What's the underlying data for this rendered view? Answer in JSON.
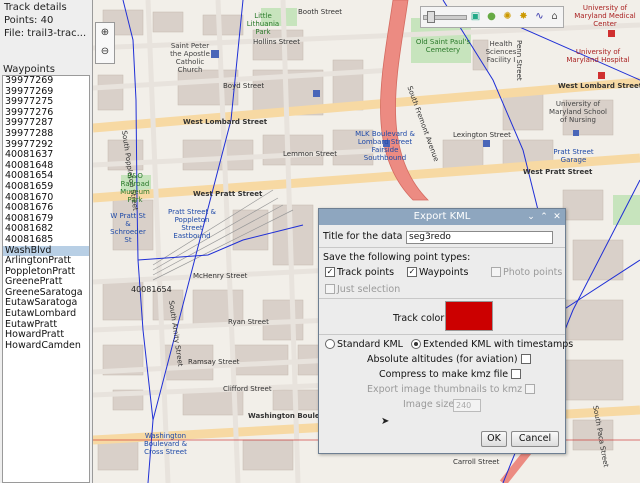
{
  "track_details": {
    "title": "Track details",
    "points": "Points: 40",
    "file": "File: trail3-trac..."
  },
  "waypoints": {
    "header": "Waypoints",
    "items": [
      "39977269",
      "39977269",
      "39977275",
      "39977276",
      "39977287",
      "39977288",
      "39977292",
      "40081637",
      "40081648",
      "40081654",
      "40081659",
      "40081670",
      "40081676",
      "40081679",
      "40081682",
      "40081685",
      "WashBlvd",
      "ArlingtonPratt",
      "PoppletonPratt",
      "GreenePratt",
      "GreeneSaratoga",
      "EutawSaratoga",
      "EutawLombard",
      "EutawPratt",
      "HowardPratt",
      "HowardCamden"
    ],
    "selected_index": 16
  },
  "map": {
    "labels": {
      "booth": "Booth Street",
      "hollins": "Hollins Street",
      "boyd": "Boyd Street",
      "lombard": "West Lombard Street",
      "pratt": "West Pratt Street",
      "lemmon": "Lemmon Street",
      "lexington": "Lexington Street",
      "mchenry": "McHenry Street",
      "ryan": "Ryan Street",
      "ramsay": "Ramsay Street",
      "clifford": "Clifford Street",
      "washington": "Washington Boulevard",
      "carroll": "Carroll Street",
      "poppleton": "South Poppleton Street",
      "amity": "South Amity Street",
      "fremont": "South Fremont Avenue",
      "saint_peter": "Saint Peter the Apostle Catholic Church",
      "old_saint_paul": "Old Saint Paul's Cemetery",
      "health_sciences": "Health Sciences Facility I",
      "umd_medical": "University of Maryland Medical Center",
      "umd_school_med": "University of Maryland School of Medicine",
      "umd_hospital": "University of Maryland Hospital",
      "umd_nursing": "University of Maryland School of Nursing",
      "little_lithuania": "Little Lithuania Park",
      "bo_museum": "B&O Railroad Museum Park",
      "pratt_poppleton": "Pratt Street & Poppleton Street Eastbound",
      "w_pratt_schroeder": "W Pratt St & Schroeder St",
      "mlk_blvd": "MLK Boulevard & Lombard Street Fairside Southbound",
      "pratt_street_garage": "Pratt Street Garage",
      "washington_cross": "Washington Boulevard & Cross Street",
      "waypoint_marker": "40081654",
      "penn_street": "Penn Street",
      "paca_street": "South Paca Street"
    }
  },
  "dialog": {
    "title": "Export KML",
    "title_label": "Title for the data",
    "title_value": "seg3redo",
    "save_label": "Save the following point types:",
    "track_points": "Track points",
    "waypoints": "Waypoints",
    "photo_points": "Photo points",
    "just_selection": "Just selection",
    "track_color_label": "Track color",
    "track_color": "#cc0000",
    "standard_kml": "Standard KML",
    "extended_kml": "Extended KML with timestamps",
    "absolute_alt": "Absolute altitudes (for aviation)",
    "compress": "Compress to make kmz file",
    "export_thumbs": "Export image thumbnails to kmz",
    "image_size_label": "Image size",
    "image_size_value": "240",
    "ok": "OK",
    "cancel": "Cancel"
  }
}
